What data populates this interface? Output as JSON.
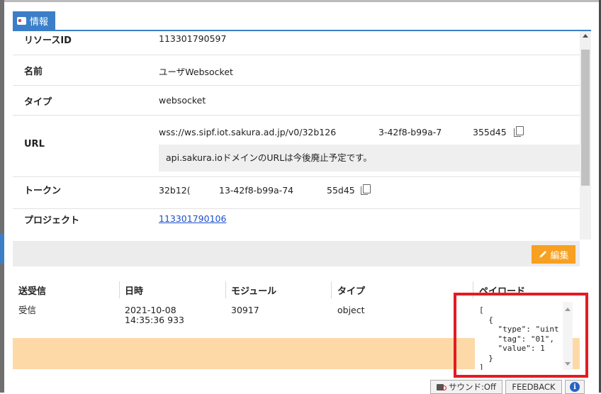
{
  "tab": {
    "label": "情報"
  },
  "info_rows": [
    {
      "label": "リソースID",
      "value": "113301790597"
    },
    {
      "label": "名前",
      "value": "ユーザWebsocket"
    },
    {
      "label": "タイプ",
      "value": "websocket"
    },
    {
      "label": "URL",
      "value_part1": "wss://ws.sipf.iot.sakura.ad.jp/v0/32b126",
      "value_part2": "3-42f8-b99a-7",
      "value_part3": "355d45",
      "notice": "api.sakura.ioドメインのURLは今後廃止予定です。"
    },
    {
      "label": "トークン",
      "value_part1": "32b12(",
      "value_part2": "13-42f8-b99a-74",
      "value_part3": "55d45"
    },
    {
      "label": "プロジェクト",
      "value": "113301790106"
    }
  ],
  "edit_button": {
    "label": "編集"
  },
  "table": {
    "headers": [
      "送受信",
      "日時",
      "モジュール",
      "タイプ",
      "ペイロード"
    ],
    "rows": [
      {
        "direction": "受信",
        "date": "2021-10-08",
        "time": "14:35:36 933",
        "module": "30917",
        "type": "object",
        "payload": "[\n  {\n    \"type\": \"uint\n    \"tag\": \"01\",\n    \"value\": 1\n  }\n]"
      }
    ]
  },
  "bottom_bar": {
    "sound_label": "サウンド:Off",
    "feedback_label": "FEEDBACK",
    "info_label": "i"
  },
  "colors": {
    "accent": "#3a7fc8",
    "edit": "#f7a021",
    "highlight_row": "#fdd9a8",
    "annotation": "#e41b23"
  }
}
